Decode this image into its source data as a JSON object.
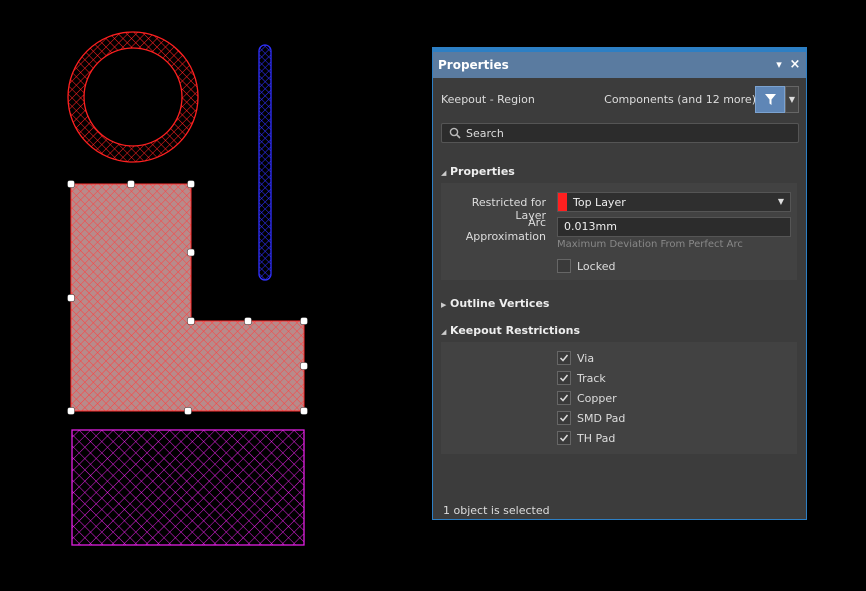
{
  "panel": {
    "title": "Properties",
    "pin_glyph": "▾",
    "close_glyph": "×",
    "object_type": "Keepout - Region",
    "filter_summary": "Components (and 12 more)",
    "filter_icon": "filter-icon",
    "search_placeholder": "Search",
    "sections": {
      "properties": {
        "label": "Properties",
        "expanded": true
      },
      "outline_vertices": {
        "label": "Outline Vertices",
        "expanded": false
      },
      "keepout_restrictions": {
        "label": "Keepout Restrictions",
        "expanded": true
      }
    },
    "restricted_for_layer": {
      "label": "Restricted for Layer",
      "value": "Top Layer",
      "swatch_color": "#ff2020"
    },
    "arc_approximation": {
      "label_line1": "Arc",
      "label_line2": "Approximation",
      "value": "0.013mm",
      "hint": "Maximum Deviation From Perfect Arc"
    },
    "locked": {
      "label": "Locked",
      "checked": false
    },
    "restrictions": [
      {
        "label": "Via",
        "checked": true
      },
      {
        "label": "Track",
        "checked": true
      },
      {
        "label": "Copper",
        "checked": true
      },
      {
        "label": "SMD Pad",
        "checked": true
      },
      {
        "label": "TH Pad",
        "checked": true
      }
    ],
    "status": "1 object is selected"
  },
  "canvas": {
    "colors": {
      "ring": "#ff2020",
      "track": "#2020ff",
      "region_selected": "#ff3030",
      "region_fill": "#c08888",
      "rect": "#e020e0",
      "handle": "#ffffff"
    }
  }
}
